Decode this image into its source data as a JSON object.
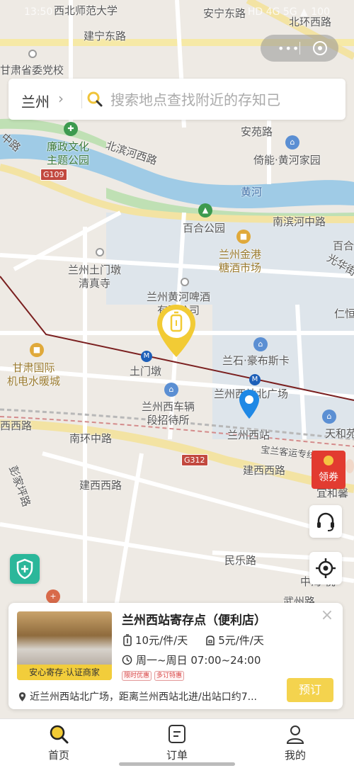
{
  "status_bar": {
    "time": "13:50",
    "right": "HD 4G 5G ▲ 100"
  },
  "search": {
    "city": "兰州",
    "placeholder": "搜索地点查找附近的存知己"
  },
  "map_labels": {
    "xibei_univ": "西北师范大学",
    "jianning_e": "建宁东路",
    "party_school": "甘肃省委党校",
    "anning_e": "安宁东路",
    "beihuan": "北环西路",
    "lianzheng": "廉政文化\n主题公园",
    "anyuan": "安苑路",
    "yineng": "倚能·黄河家园",
    "beibin": "北滨河西路",
    "zhonglu": "中路",
    "g109": "G109",
    "huanghe": "黄河",
    "baihe_park": "百合公园",
    "nanbin": "南滨河中路",
    "baihe_right": "百合",
    "jingang": "兰州金港\n糖酒市场",
    "guanghua": "光华街",
    "tumendun_mosque": "兰州土门墩\n清真寺",
    "beer": "兰州黄河啤酒\n有限公司",
    "renai": "仁恒",
    "gansu_intl": "甘肃国际\n机电水暖城",
    "tumendun": "土门墩",
    "lanshi": "兰石·豪布斯卡",
    "north_square": "兰州西站北广场",
    "vehicle_hostel": "兰州西车辆\n段招待所",
    "xi_station": "兰州西站",
    "tianhe": "天和苑",
    "xixi_road": "西西路",
    "nanhuan": "南环中路",
    "g312": "G312",
    "baolan": "宝兰客运专线",
    "pengjiaping": "彭家坪路",
    "jianxi_w": "建西西路",
    "jianxi_e": "建西西路",
    "yihexin": "宜和馨",
    "minle": "民乐路",
    "zhongxin": "中海·悦",
    "wuzhou": "武州路"
  },
  "coupon": {
    "label": "领券"
  },
  "card": {
    "store_name": "兰州西站寄存点（便利店）",
    "badge": "安心寄存·认证商家",
    "price_large": "10元/件/天",
    "price_small": "5元/件/天",
    "hours": "周一~周日 07:00~24:00",
    "tags": [
      "限时优惠",
      "多订特惠"
    ],
    "address": "近兰州西站北广场，距离兰州西站北进/出站口约7...",
    "book": "预订"
  },
  "tabs": [
    {
      "label": "首页",
      "icon": "search-icon"
    },
    {
      "label": "订单",
      "icon": "order-icon"
    },
    {
      "label": "我的",
      "icon": "user-icon"
    }
  ]
}
